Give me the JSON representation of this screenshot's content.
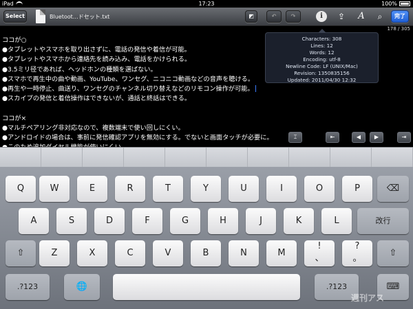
{
  "status": {
    "device": "iPad",
    "time": "17:23",
    "battery": "100%"
  },
  "toolbar": {
    "select_label": "Select",
    "filename": "Bluetoot…ドセット.txt",
    "resize_glyph": "◩",
    "undo_glyph": "↶",
    "redo_glyph": "↷",
    "info_glyph": "i",
    "share_glyph": "⇪",
    "font_glyph": "A",
    "search_glyph": "⌕",
    "done_label": "完了"
  },
  "counter": "178 / 305",
  "editor": {
    "lines": [
      "ココが○",
      "●タブレットやスマホを取り出さずに、電話の発信や着信が可能。",
      "●タブレットやスマホから連絡先を読み込み、電話をかけられる。",
      "●3.5ミリ径であれば、ヘッドホンの種類を選ばない。",
      "●スマホで再生中の曲や動画、YouTube、ワンセグ、ニコニコ動画などの音声を聴ける。",
      "●再生や一時停止、曲送り、ワンセグのチャンネル切り替えなどのリモコン操作が可能。",
      "●スカイプの発信と着信操作はできないが、通話と終話はできる。",
      "",
      "ココが×",
      "●マルチペアリング非対応なので、複数端末で使い回しにくい。",
      "●アンドロイドの場合は、事前に発信確認アプリを無効にする。でないと画面タッチが必要に。",
      "●このため追加ダイヤル機能が使いにくい。"
    ]
  },
  "info_popover": {
    "characters": "Characters: 308",
    "lines": "Lines: 12",
    "words": "Words: 12",
    "encoding": "Encoding: utf-8",
    "newline": "Newline Code: LF (UNIX/Mac)",
    "revision": "Revision: 1350835156",
    "updated": "Updated: 2011/04/30 12:32"
  },
  "nav": {
    "cursor_glyph": "⌶",
    "first_glyph": "⇤",
    "prev_glyph": "◀",
    "next_glyph": "▶",
    "last_glyph": "⇥"
  },
  "keyboard": {
    "row1": [
      "Q",
      "W",
      "E",
      "R",
      "T",
      "Y",
      "U",
      "I",
      "O",
      "P"
    ],
    "backspace_glyph": "⌫",
    "row2": [
      "A",
      "S",
      "D",
      "F",
      "G",
      "H",
      "J",
      "K",
      "L"
    ],
    "return_label": "改行",
    "shift_glyph": "⇧",
    "row3": [
      "Z",
      "X",
      "C",
      "V",
      "B",
      "N",
      "M"
    ],
    "excl_top": "!",
    "excl_bottom": "、",
    "q_top": "?",
    "q_bottom": "。",
    "numbers_label": ".?123",
    "globe_glyph": "🌐",
    "dismiss_glyph": "⌨"
  },
  "watermark": "週刊アス"
}
